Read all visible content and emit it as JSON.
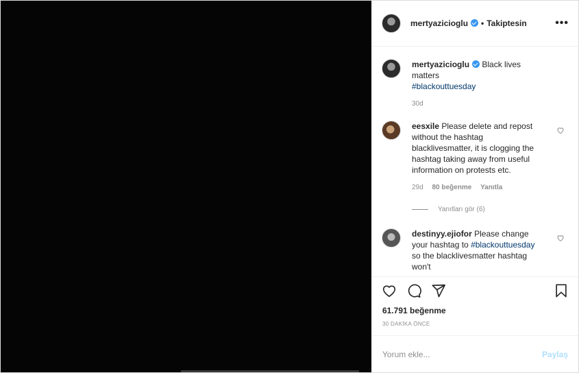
{
  "header": {
    "username": "mertyazicioglu",
    "separator": "•",
    "follow_status": "Takiptesin",
    "more_label": "•••"
  },
  "caption": {
    "username": "mertyazicioglu",
    "text": "Black lives matters",
    "hashtag": "#blackouttuesday",
    "age": "30d"
  },
  "comments": [
    {
      "username": "eesxile",
      "text": "Please delete and repost without the hashtag blacklivesmatter, it is clogging the hashtag taking away from useful information on protests etc.",
      "age": "29d",
      "likes": "80 beğenme",
      "reply_label": "Yanıtla",
      "view_replies": "Yanıtları gör (6)"
    },
    {
      "username": "destinyy.ejiofor",
      "text_before": "Please change your hashtag to",
      "hashtag": "#blackouttuesday",
      "text_after": "so the blacklivesmatter hashtag won't"
    }
  ],
  "likes_count": "61.791 beğenme",
  "posted_time": "30 DAKİKA ÖNCE",
  "add_comment": {
    "placeholder": "Yorum ekle...",
    "post_label": "Paylaş"
  },
  "icons": {
    "like": "heart-icon",
    "comment": "comment-icon",
    "share": "send-icon",
    "save": "bookmark-icon",
    "verified": "verified-badge-icon"
  },
  "colors": {
    "verified": "#3897f0",
    "hashtag": "#00376b",
    "post_disabled": "#b2dffc",
    "muted": "#8e8e8e",
    "media_bg": "#050505"
  }
}
